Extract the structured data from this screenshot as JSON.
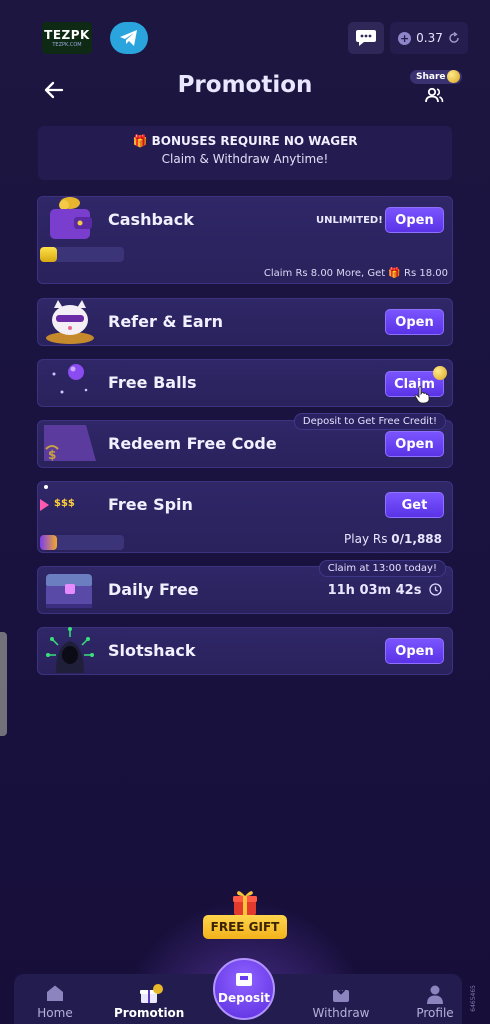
{
  "topbar": {
    "logo_text": "TEZPK",
    "logo_sub": "TEZPK.COM",
    "balance": "0.37"
  },
  "header": {
    "title": "Promotion",
    "share_label": "Share"
  },
  "banner": {
    "line1": "BONUSES REQUIRE NO WAGER",
    "line2": "Claim & Withdraw Anytime!"
  },
  "cards": {
    "cashback": {
      "name": "Cashback",
      "badge": "UNLIMITED!",
      "button": "Open",
      "progress": 0.2,
      "note_prefix": "Claim Rs 8.00 More, Get",
      "note_suffix": "Rs 18.00"
    },
    "refer": {
      "name": "Refer & Earn",
      "button": "Open"
    },
    "balls": {
      "name": "Free Balls",
      "button": "Claim"
    },
    "redeem": {
      "name": "Redeem Free Code",
      "button": "Open",
      "tag": "Deposit to Get Free Credit!"
    },
    "spin": {
      "name": "Free Spin",
      "button": "Get",
      "icon_text": "$$$",
      "progress": 0.2,
      "note_prefix": "Play Rs",
      "note_value": "0/1,888"
    },
    "daily": {
      "name": "Daily Free",
      "tag": "Claim at 13:00 today!",
      "timer": "11h 03m 42s"
    },
    "slotshack": {
      "name": "Slotshack",
      "button": "Open"
    }
  },
  "free_gift": {
    "label": "FREE GIFT"
  },
  "nav": {
    "home": "Home",
    "promotion": "Promotion",
    "deposit": "Deposit",
    "withdraw": "Withdraw",
    "profile": "Profile"
  },
  "side_code": "6465465",
  "colors": {
    "accent": "#6a44f2",
    "gold": "#f2c21b",
    "background": "#1b1440"
  }
}
